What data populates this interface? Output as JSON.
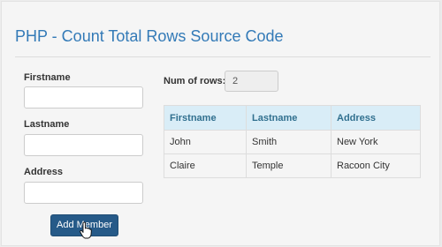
{
  "page": {
    "title": "PHP - Count Total Rows Source Code"
  },
  "form": {
    "firstname_label": "Firstname",
    "firstname_value": "",
    "lastname_label": "Lastname",
    "lastname_value": "",
    "address_label": "Address",
    "address_value": "",
    "submit_label": "Add Member"
  },
  "count": {
    "label": "Num of rows:",
    "value": "2"
  },
  "table": {
    "headers": [
      "Firstname",
      "Lastname",
      "Address"
    ],
    "rows": [
      [
        "John",
        "Smith",
        "New York"
      ],
      [
        "Claire",
        "Temple",
        "Racoon City"
      ]
    ]
  },
  "colors": {
    "title": "#337ab7",
    "button": "#265a88",
    "table_header_bg": "#d9edf7",
    "table_header_text": "#31708f"
  },
  "icons": {
    "cursor": "hand-pointer-icon"
  }
}
